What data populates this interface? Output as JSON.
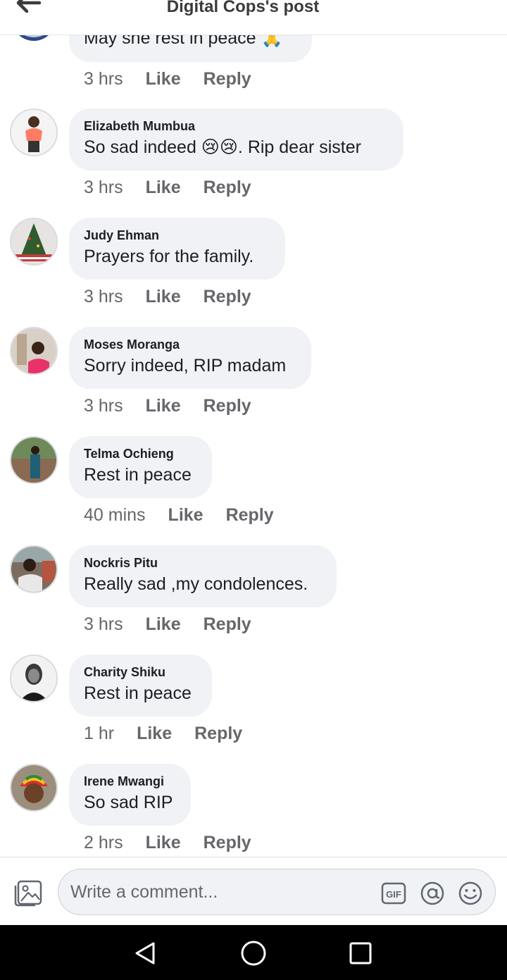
{
  "header": {
    "title": "Digital Cops's post"
  },
  "partial_comment": {
    "text": "May she rest in peace 🙏",
    "time": "3 hrs"
  },
  "actions": {
    "like": "Like",
    "reply": "Reply"
  },
  "comments": [
    {
      "author": "Elizabeth Mumbua",
      "text": "So sad indeed 😢😢. Rip dear sister",
      "time": "3 hrs"
    },
    {
      "author": "Judy Ehman",
      "text": "Prayers for the family.",
      "time": "3 hrs"
    },
    {
      "author": "Moses Moranga",
      "text": "Sorry indeed, RIP madam",
      "time": "3 hrs"
    },
    {
      "author": "Telma Ochieng",
      "text": "Rest in peace",
      "time": "40 mins"
    },
    {
      "author": "Nockris Pitu",
      "text": "Really sad ,my condolences.",
      "time": "3 hrs"
    },
    {
      "author": "Charity Shiku",
      "text": "Rest in peace",
      "time": "1 hr"
    },
    {
      "author": "Irene Mwangi",
      "text": "So sad RIP",
      "time": "2 hrs"
    }
  ],
  "composer": {
    "placeholder": "Write a comment..."
  },
  "icons": {
    "back": "arrow-left-icon",
    "photo": "photo-icon",
    "gif": "gif-icon",
    "mention": "at-sign-icon",
    "emoji": "smiley-icon",
    "nav_back": "triangle-back-icon",
    "nav_home": "circle-home-icon",
    "nav_recent": "square-recents-icon"
  },
  "colors": {
    "bubble": "#f0f2f5",
    "meta": "#65676b",
    "text": "#1c1e21",
    "navbar": "#000000"
  }
}
